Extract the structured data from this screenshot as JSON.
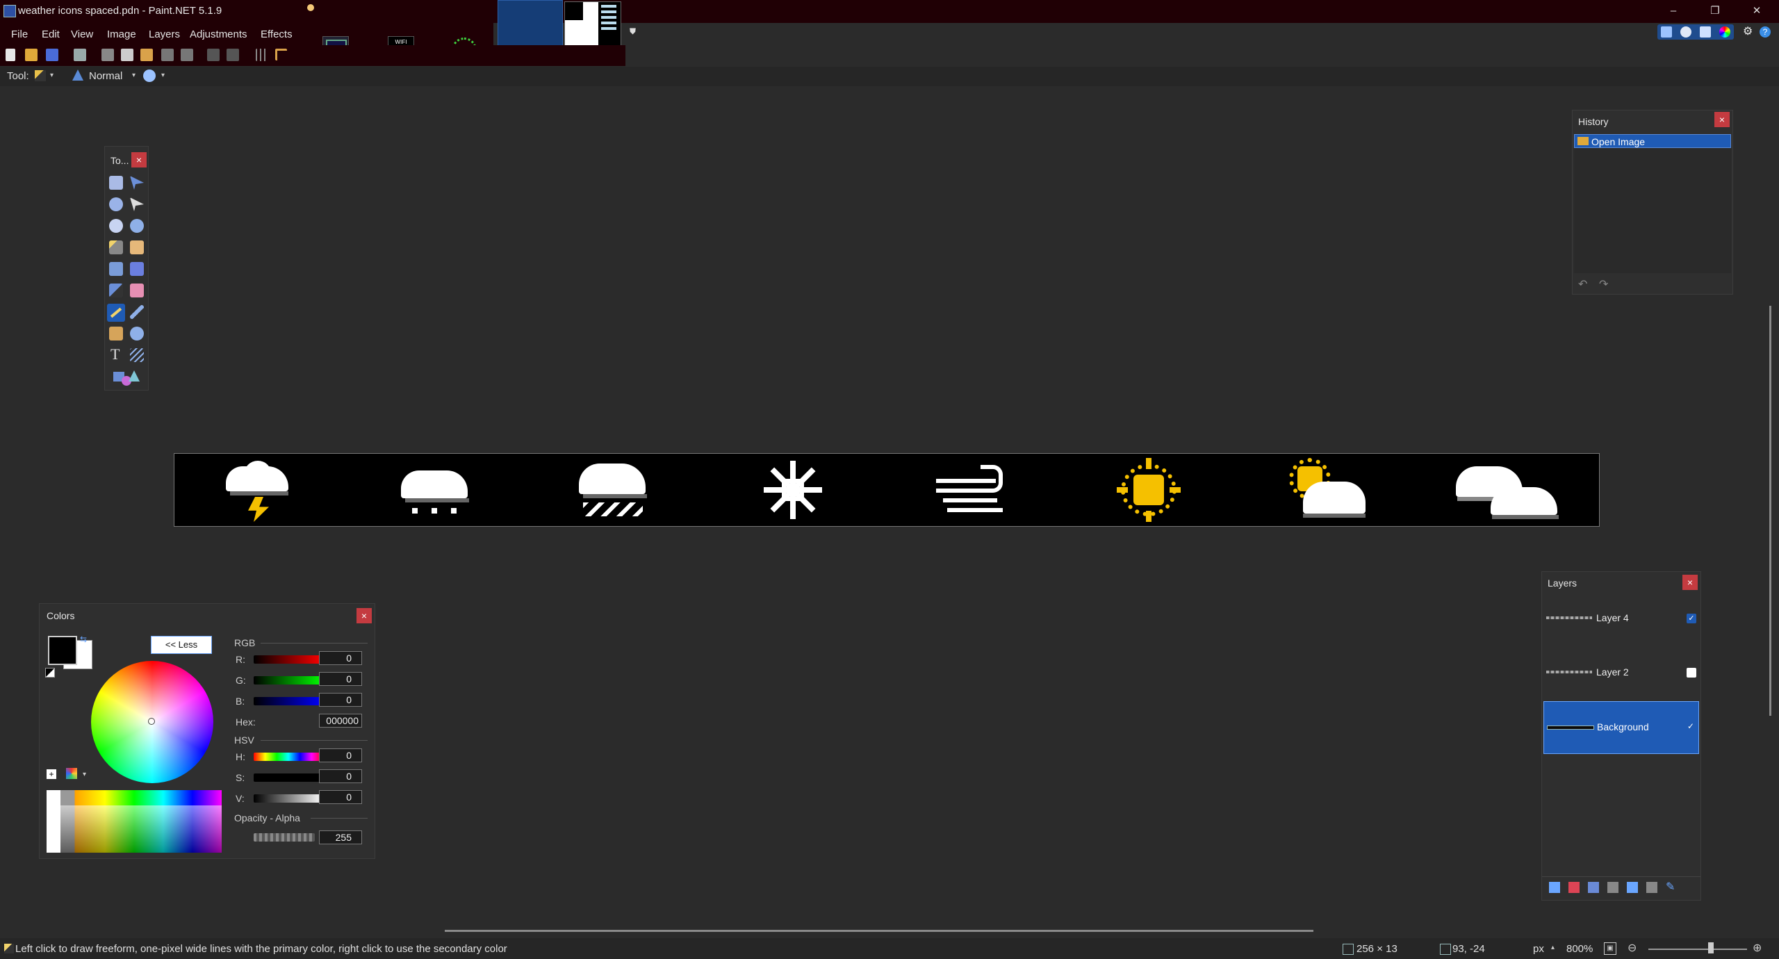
{
  "window": {
    "title": "weather icons spaced.pdn - Paint.NET 5.1.9",
    "minimize_glyph": "–",
    "maximize_glyph": "❐",
    "close_glyph": "✕"
  },
  "menu": {
    "items": [
      "File",
      "Edit",
      "View",
      "Image",
      "Layers",
      "Adjustments",
      "Effects"
    ]
  },
  "thumbnails": [
    {
      "name": "image-thumb-1"
    },
    {
      "name": "image-thumb-wifi",
      "label": "WIFI\nConnect"
    },
    {
      "name": "image-thumb-3"
    },
    {
      "name": "image-thumb-active"
    },
    {
      "name": "image-thumb-5"
    }
  ],
  "toolbar": {
    "tool_label": "Tool:",
    "blend_mode": "Normal"
  },
  "tools_panel": {
    "title": "To...",
    "close": "×",
    "tools": [
      "rectangle-select-icon",
      "move-selection-icon",
      "lasso-select-icon",
      "move-selected-icon",
      "ellipse-select-icon",
      "zoom-icon",
      "magic-wand-icon",
      "pan-icon",
      "paint-bucket-icon",
      "gradient-icon",
      "paintbrush-icon",
      "eraser-icon",
      "pencil-icon",
      "color-picker-icon",
      "clone-stamp-icon",
      "recolor-icon",
      "text-icon",
      "line-curve-icon",
      "shapes-icon"
    ]
  },
  "history_panel": {
    "title": "History",
    "close": "×",
    "items": [
      {
        "label": "Open Image",
        "selected": true
      }
    ],
    "undo_icon": "undo-icon",
    "redo_icon": "redo-icon"
  },
  "canvas": {
    "background": "#000000",
    "icons": [
      "thunderstorm-icon",
      "rain-cloud-icon",
      "snow-rain-cloud-icon",
      "snowflake-icon",
      "wind-icon",
      "sun-icon",
      "partly-sunny-icon",
      "cloudy-icon"
    ]
  },
  "colors_panel": {
    "title": "Colors",
    "close": "×",
    "less_button": "<< Less",
    "rgb_label": "RGB",
    "hsv_label": "HSV",
    "r_label": "R:",
    "g_label": "G:",
    "b_label": "B:",
    "h_label": "H:",
    "s_label": "S:",
    "v_label": "V:",
    "hex_label": "Hex:",
    "opacity_label": "Opacity - Alpha",
    "r": "0",
    "g": "0",
    "b": "0",
    "h": "0",
    "s": "0",
    "v": "0",
    "hex": "000000",
    "alpha": "255",
    "primary_color": "#000000",
    "secondary_color": "#ffffff"
  },
  "layers_panel": {
    "title": "Layers",
    "close": "×",
    "layers": [
      {
        "name": "Layer 4",
        "visible": true,
        "selected": false
      },
      {
        "name": "Layer 2",
        "visible": false,
        "selected": false
      },
      {
        "name": "Background",
        "visible": true,
        "selected": true
      }
    ]
  },
  "status": {
    "hint": "Left click to draw freeform, one-pixel wide lines with the primary color, right click to use the secondary color",
    "image_size": "256 × 13",
    "cursor_pos": "93, -24",
    "units": "px",
    "zoom": "800%"
  },
  "colors": {
    "accent": "#1f5bb5",
    "close_red": "#c43b40",
    "title_bg": "#200005",
    "sun_yellow": "#f5c000"
  }
}
